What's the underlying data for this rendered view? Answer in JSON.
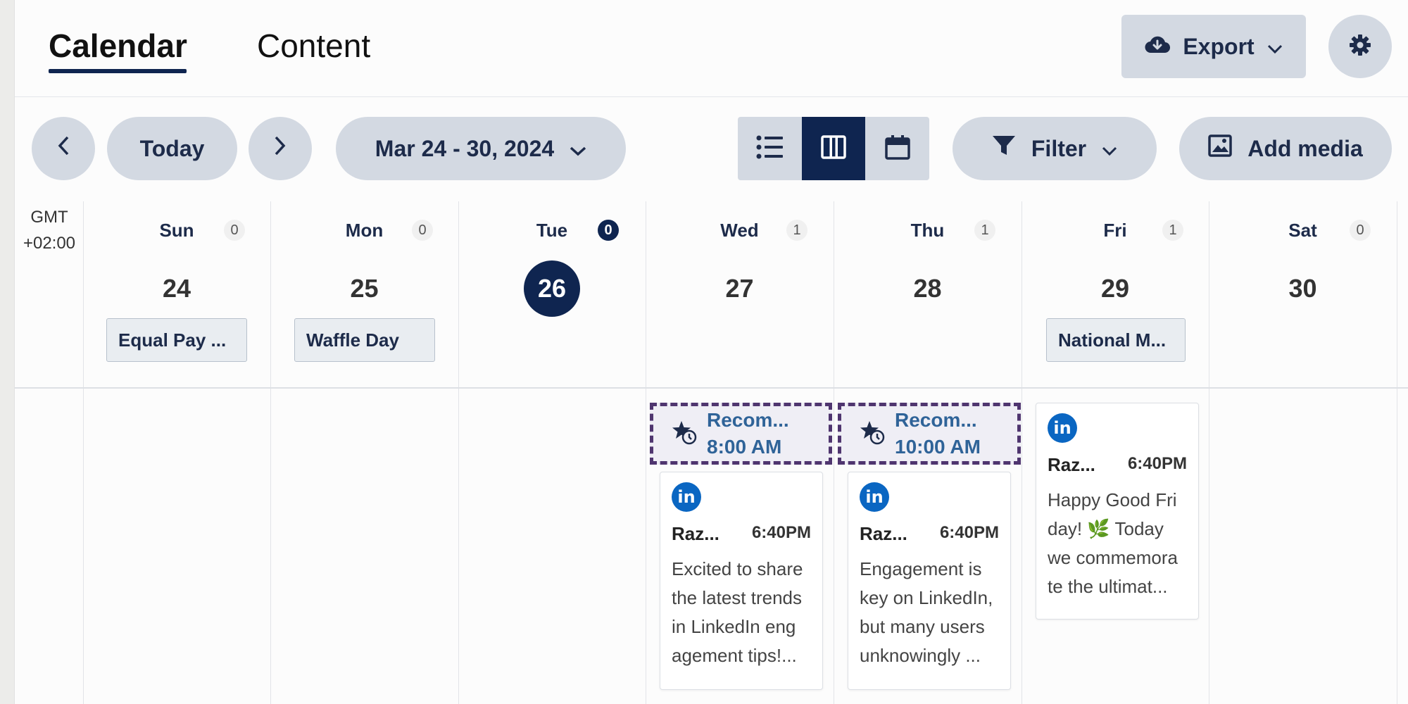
{
  "tabs": [
    {
      "label": "Calendar",
      "active": true
    },
    {
      "label": "Content",
      "active": false
    }
  ],
  "header": {
    "export_label": "Export",
    "export_icon": "cloud-download-icon",
    "settings_icon": "gear-icon"
  },
  "toolbar": {
    "today_label": "Today",
    "date_range": "Mar 24 - 30, 2024",
    "views": [
      "list",
      "week",
      "month"
    ],
    "active_view": "week",
    "filter_label": "Filter",
    "add_media_label": "Add media"
  },
  "timezone": {
    "line1": "GMT",
    "line2": "+02:00"
  },
  "days": [
    {
      "name": "Sun",
      "num": "24",
      "count": "0",
      "holiday": "Equal Pay ..."
    },
    {
      "name": "Mon",
      "num": "25",
      "count": "0",
      "holiday": "Waffle Day"
    },
    {
      "name": "Tue",
      "num": "26",
      "count": "0",
      "today": true
    },
    {
      "name": "Wed",
      "num": "27",
      "count": "1"
    },
    {
      "name": "Thu",
      "num": "28",
      "count": "1"
    },
    {
      "name": "Fri",
      "num": "29",
      "count": "1",
      "holiday": "National M..."
    },
    {
      "name": "Sat",
      "num": "30",
      "count": "0"
    }
  ],
  "recommended": [
    {
      "label": "Recom...",
      "time": "8:00 AM",
      "day": "Wed"
    },
    {
      "label": "Recom...",
      "time": "10:00 AM",
      "day": "Thu"
    }
  ],
  "posts": [
    {
      "day": "Wed",
      "network": "LinkedIn",
      "author": "Raz...",
      "time": "6:40PM",
      "lines": [
        "Excited to share",
        "the latest trends",
        "in LinkedIn eng",
        "agement tips!..."
      ]
    },
    {
      "day": "Thu",
      "network": "LinkedIn",
      "author": "Raz...",
      "time": "6:40PM",
      "lines": [
        "Engagement is",
        "key on LinkedIn,",
        "but many users",
        "unknowingly ..."
      ]
    },
    {
      "day": "Fri",
      "network": "LinkedIn",
      "author": "Raz...",
      "time": "6:40PM",
      "lines": [
        "Happy Good Fri",
        "day! 🌿 Today",
        "we commemora",
        "te the ultimat..."
      ]
    }
  ],
  "colors": {
    "accent": "#0f2550",
    "button_bg": "#d3d9e2",
    "recommended_border": "#4f356f",
    "recommended_text": "#2f6398",
    "linkedin": "#0a66c2"
  }
}
